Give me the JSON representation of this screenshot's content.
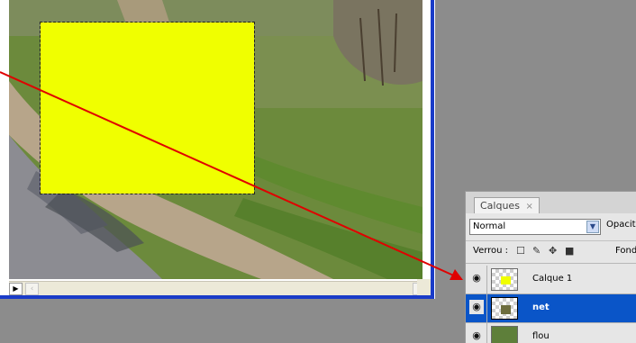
{
  "layers_panel": {
    "tab_label": "Calques",
    "tab_close": "×",
    "blend_mode": "Normal",
    "opacity_label": "Opacité",
    "lock_label": "Verrou :",
    "fill_label": "Fond",
    "layers": [
      {
        "name": "Calque 1",
        "selected": false,
        "thumbnail": "yellow-rectangle"
      },
      {
        "name": "net",
        "selected": true,
        "thumbnail": "photo-patch"
      },
      {
        "name": "flou",
        "selected": false,
        "thumbnail": "photo"
      }
    ]
  },
  "icons": {
    "eye": "eye-icon",
    "lock_transparency": "lock-transparency-icon",
    "lock_pixels": "brush-icon",
    "lock_position": "move-icon",
    "lock_all": "padlock-icon",
    "dropdown": "chevron-down-icon",
    "scroll_left": "scroll-left-icon",
    "scroll_right": "scroll-right-icon"
  },
  "colors": {
    "selection_fill": "#f0ff00",
    "window_border": "#1a3cc8",
    "selected_layer": "#0a55c8",
    "annotation_arrow": "#e00000"
  }
}
